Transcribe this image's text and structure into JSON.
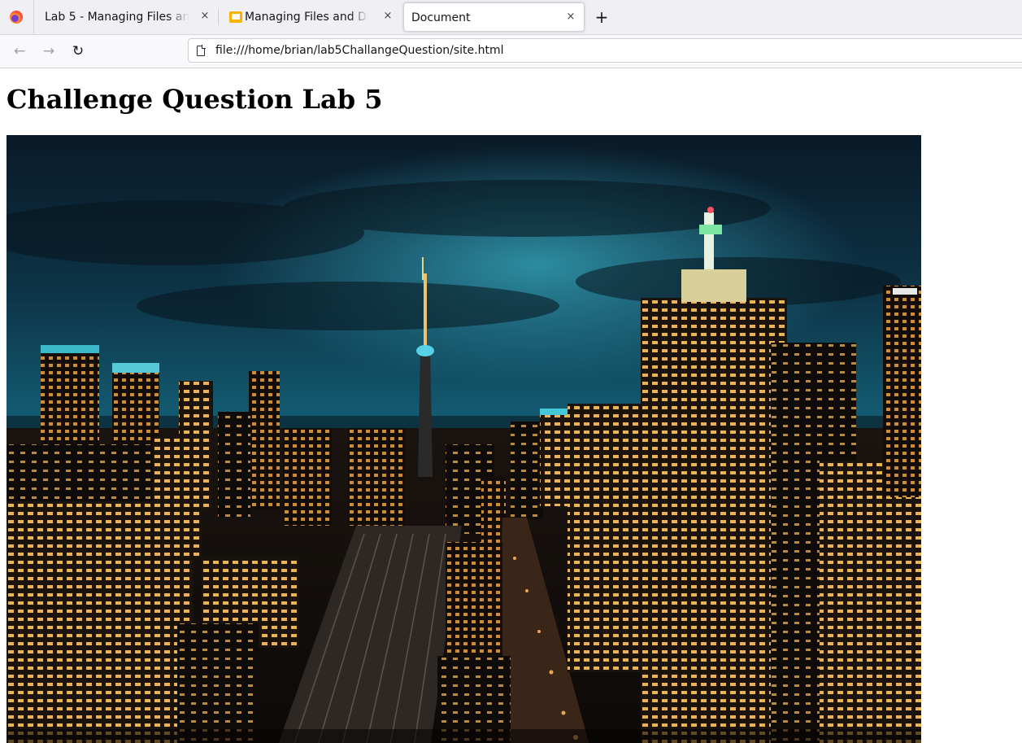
{
  "browser": {
    "tabs": [
      {
        "title": "Lab 5 - Managing Files and Directories",
        "active": false
      },
      {
        "title": "Managing Files and Directories",
        "active": false
      },
      {
        "title": "Document",
        "active": true
      }
    ],
    "close_glyph": "×",
    "new_tab_glyph": "+",
    "back_glyph": "←",
    "forward_glyph": "→",
    "reload_glyph": "↻",
    "url": "file:///home/brian/lab5ChallangeQuestion/site.html"
  },
  "page": {
    "heading": "Challenge Question Lab 5",
    "image": {
      "description_icon": "city-skyline-image",
      "colors": {
        "sky_top": "#0b1c2a",
        "sky_mid": "#0f4a5e",
        "glow": "#2aa8c4",
        "lights": "#f2c46a"
      }
    }
  },
  "icons": {
    "firefox": "firefox-logo-icon",
    "slides": "slides-icon",
    "page": "page-icon"
  }
}
